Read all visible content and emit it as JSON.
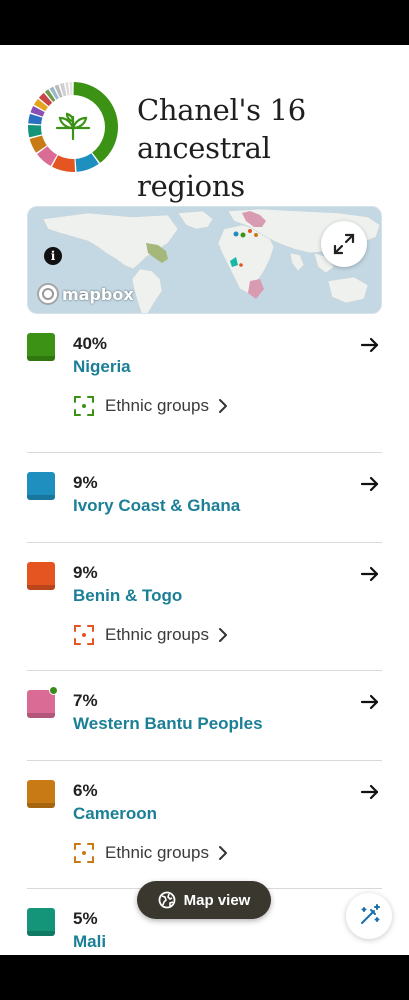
{
  "header": {
    "title": "Chanel's 16 ancestral regions",
    "donut_segments": [
      {
        "color": "#3b9214",
        "share": 40
      },
      {
        "color": "#1e8fbf",
        "share": 9
      },
      {
        "color": "#e45522",
        "share": 9
      },
      {
        "color": "#d96b95",
        "share": 7
      },
      {
        "color": "#c87b14",
        "share": 6
      },
      {
        "color": "#14957a",
        "share": 5
      },
      {
        "color": "#2a6fc0",
        "share": 4
      },
      {
        "color": "#8a4fb5",
        "share": 3
      },
      {
        "color": "#e2a51c",
        "share": 3
      },
      {
        "color": "#c94646",
        "share": 3
      },
      {
        "color": "#6f9a4b",
        "share": 2
      },
      {
        "color": "#9ab8cc",
        "share": 2
      },
      {
        "color": "#bbbbbb",
        "share": 2
      },
      {
        "color": "#cfcfcf",
        "share": 2
      },
      {
        "color": "#dadada",
        "share": 1.5
      },
      {
        "color": "#e3e3e3",
        "share": 1.5
      }
    ],
    "donut_icon": "leaf-icon"
  },
  "map": {
    "logo_text": "mapbox",
    "info_icon": "info-icon",
    "info_glyph": "i",
    "expand_icon": "expand-icon"
  },
  "regions": [
    {
      "percent": "40%",
      "name": "Nigeria",
      "color": "#3b9214",
      "ethnic_groups": true,
      "eg_color": "#3b9214",
      "has_badge": false
    },
    {
      "percent": "9%",
      "name": "Ivory Coast & Ghana",
      "color": "#1e8fbf",
      "ethnic_groups": false,
      "has_badge": false
    },
    {
      "percent": "9%",
      "name": "Benin & Togo",
      "color": "#e45522",
      "ethnic_groups": true,
      "eg_color": "#e45522",
      "has_badge": false
    },
    {
      "percent": "7%",
      "name": "Western Bantu Peoples",
      "color": "#d96b95",
      "ethnic_groups": false,
      "has_badge": true
    },
    {
      "percent": "6%",
      "name": "Cameroon",
      "color": "#c87b14",
      "ethnic_groups": true,
      "eg_color": "#c87b14",
      "has_badge": false
    },
    {
      "percent": "5%",
      "name": "Mali",
      "color": "#14957a",
      "ethnic_groups": false,
      "has_badge": false
    }
  ],
  "ethnic_groups_label": "Ethnic groups",
  "map_view_button": {
    "label": "Map view",
    "icon": "globe-icon"
  },
  "magic_button": {
    "icon": "magic-wand-icon"
  }
}
